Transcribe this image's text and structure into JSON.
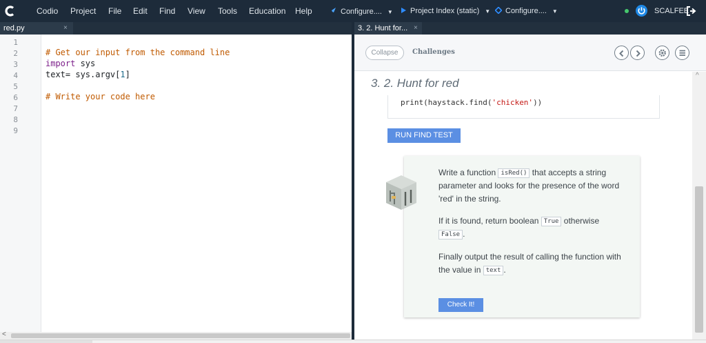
{
  "app": {
    "menu": [
      "Codio",
      "Project",
      "File",
      "Edit",
      "Find",
      "View",
      "Tools",
      "Education",
      "Help"
    ],
    "configure_1": "Configure....",
    "project_index": "Project Index (static)",
    "configure_2": "Configure....",
    "user": "SCALFEE"
  },
  "editor": {
    "tab_label": "red.py",
    "tab_close": "×",
    "line_numbers": [
      "1",
      "2",
      "3",
      "4",
      "5",
      "6",
      "7",
      "8",
      "9"
    ],
    "lines": {
      "l2": "# Get our input from the command line",
      "l3_kw": "import",
      "l3_rest": " sys",
      "l4_a": "text= sys.argv[",
      "l4_num": "1",
      "l4_b": "]",
      "l6": "# Write your code here"
    },
    "scroll_left": "<"
  },
  "guide": {
    "tab_label": "3. 2. Hunt for...",
    "tab_close": "×",
    "collapse": "Collapse",
    "challenges": "Challenges",
    "heading": "3. 2. Hunt for red",
    "code_a": "print(haystack.find(",
    "code_str": "'chicken'",
    "code_b": "))",
    "run_button": "RUN FIND TEST",
    "p1_a": "Write a function ",
    "p1_code": "isRed()",
    "p1_b": " that accepts a string parameter and looks for the presence of the word 'red' in the string.",
    "p2_a": "If it is found, return boolean ",
    "p2_code1": "True",
    "p2_b": " otherwise ",
    "p2_code2": "False",
    "p2_c": ".",
    "p3_a": "Finally output the result of calling the function with the value in ",
    "p3_code": "text",
    "p3_b": ".",
    "check_button": "Check It!"
  },
  "colors": {
    "menubar": "#1d2b3a",
    "accent": "#5b8fe3",
    "comment": "#c05a00",
    "keyword": "#7c1f8a"
  },
  "icons": [
    "codio-logo-icon",
    "rocket-icon",
    "play-icon",
    "diamond-icon",
    "status-dot-icon",
    "power-icon",
    "logout-icon",
    "prev-icon",
    "next-icon",
    "settings-icon",
    "menu-icon",
    "robot-icon"
  ]
}
